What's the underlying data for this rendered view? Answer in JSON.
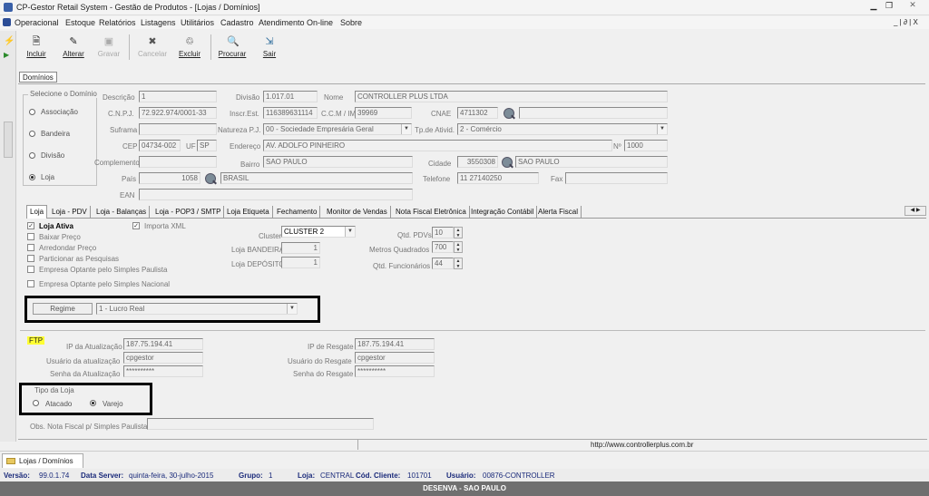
{
  "window": {
    "title": "CP-Gestor Retail System - Gestão de Produtos - [Lojas / Domínios]"
  },
  "menu": {
    "items": [
      "Operacional",
      "Estoque",
      "Relatórios",
      "Listagens",
      "Utilitários",
      "Cadastro",
      "Atendimento On-line",
      "Sobre"
    ],
    "mdi_controls": "_ | ∂ | X"
  },
  "toolbar": {
    "incluir": "Incluir",
    "alterar": "Alterar",
    "gravar": "Gravar",
    "cancelar": "Cancelar",
    "excluir": "Excluir",
    "procurar": "Procurar",
    "sair": "Sair"
  },
  "dominios_tab": "Domínios",
  "sel_dominio": {
    "title": "Selecione o Domínio",
    "opt1": "Associação",
    "opt2": "Bandeira",
    "opt3": "Divisão",
    "opt4": "Loja",
    "selected": "Loja"
  },
  "form": {
    "descricao_label": "Descrição",
    "descricao": "1",
    "divisao_label": "Divisão",
    "divisao": "1.017.01",
    "nome_label": "Nome",
    "nome": "CONTROLLER PLUS LTDA",
    "cnpj_label": "C.N.P.J.",
    "cnpj": "72.922.974/0001-33",
    "inscr_label": "Inscr.Est.",
    "inscr": "116389631114",
    "ccm_label": "C.C.M / IM",
    "ccm": "39969",
    "cnae_label": "CNAE",
    "cnae": "4711302",
    "suframa_label": "Suframa",
    "natureza_label": "Natureza P.J.",
    "natureza": "00 - Sociedade Empresária Geral",
    "tpativ_label": "Tp.de Ativid.",
    "tpativ": "2 - Comércio",
    "cep_label": "CEP",
    "cep": "04734-002",
    "uf_label": "UF",
    "uf": "SP",
    "endereco_label": "Endereço",
    "endereco": "AV. ADOLFO PINHEIRO",
    "numero_label": "Nº",
    "numero": "1000",
    "complemento_label": "Complemento",
    "bairro_label": "Bairro",
    "bairro": "SAO PAULO",
    "cidade_label": "Cidade",
    "cidade_cod": "3550308",
    "cidade": "SAO PAULO",
    "pais_label": "País",
    "pais_cod": "1058",
    "pais": "BRASIL",
    "telefone_label": "Telefone",
    "telefone": "11 27140250",
    "fax_label": "Fax",
    "ean_label": "EAN"
  },
  "tabs": [
    "Loja",
    "Loja - PDV",
    "Loja - Balanças",
    "Loja - POP3 / SMTP",
    "Loja Etiqueta",
    "Fechamento",
    "Monitor de Vendas",
    "Nota Fiscal Eletrônica",
    "Integração Contábil",
    "Alerta Fiscal"
  ],
  "loja": {
    "loja_ativa": "Loja Ativa",
    "importa_xml": "Importa XML",
    "baixar_preco": "Baixar Preço",
    "arredondar": "Arredondar Preço",
    "particionar": "Particionar as Pesquisas",
    "simples_paulista": "Empresa Optante pelo Simples Paulista",
    "simples_nacional": "Empresa Optante pelo Simples Nacional",
    "cluster_label": "Cluster",
    "cluster": "CLUSTER 2",
    "loja_bandeira_label": "Loja BANDEIRA",
    "loja_bandeira": "1",
    "loja_deposito_label": "Loja DEPÓSITO",
    "loja_deposito": "1",
    "qtd_pdvs_label": "Qtd. PDVs",
    "qtd_pdvs": "10",
    "metros_label": "Metros Quadrados",
    "metros": "700",
    "qtd_func_label": "Qtd. Funcionários",
    "qtd_func": "44",
    "regime_btn": "Regime",
    "regime": "1 - Lucro Real"
  },
  "ftp": {
    "label": "FTP",
    "ip_atual_label": "IP da Atualização",
    "ip_atual": "187.75.194.41",
    "usuario_atual_label": "Usuário da atualização",
    "usuario_atual": "cpgestor",
    "senha_atual_label": "Senha da Atualização",
    "senha_atual": "**********",
    "ip_resgate_label": "IP de Resgate",
    "ip_resgate": "187.75.194.41",
    "usuario_resgate_label": "Usuário do Resgate",
    "usuario_resgate": "cpgestor",
    "senha_resgate_label": "Senha do Resgate",
    "senha_resgate": "**********"
  },
  "tipo_loja": {
    "title": "Tipo da Loja",
    "atacado": "Atacado",
    "varejo": "Varejo",
    "selected": "Varejo"
  },
  "obs_label": "Obs. Nota Fiscal p/ Simples Paulista",
  "url": "http://www.controllerplus.com.br",
  "taskbar_tab": "Lojas / Domínios",
  "status": {
    "versao_label": "Versão:",
    "versao": "99.0.1.74",
    "server_label": "Data Server:",
    "server": "quinta-feira, 30-julho-2015",
    "grupo_label": "Grupo:",
    "grupo": "1",
    "loja_label": "Loja:",
    "loja": "CENTRAL",
    "cliente_label": "Cód. Cliente:",
    "cliente": "101701",
    "usuario_label": "Usuário:",
    "usuario": "00876-CONTROLLER"
  },
  "footer": "DESENVA - SAO PAULO",
  "colors": {
    "highlight": "#ffff33",
    "footer_bg": "#6f6f6f",
    "status_text": "#1a2a7a"
  }
}
